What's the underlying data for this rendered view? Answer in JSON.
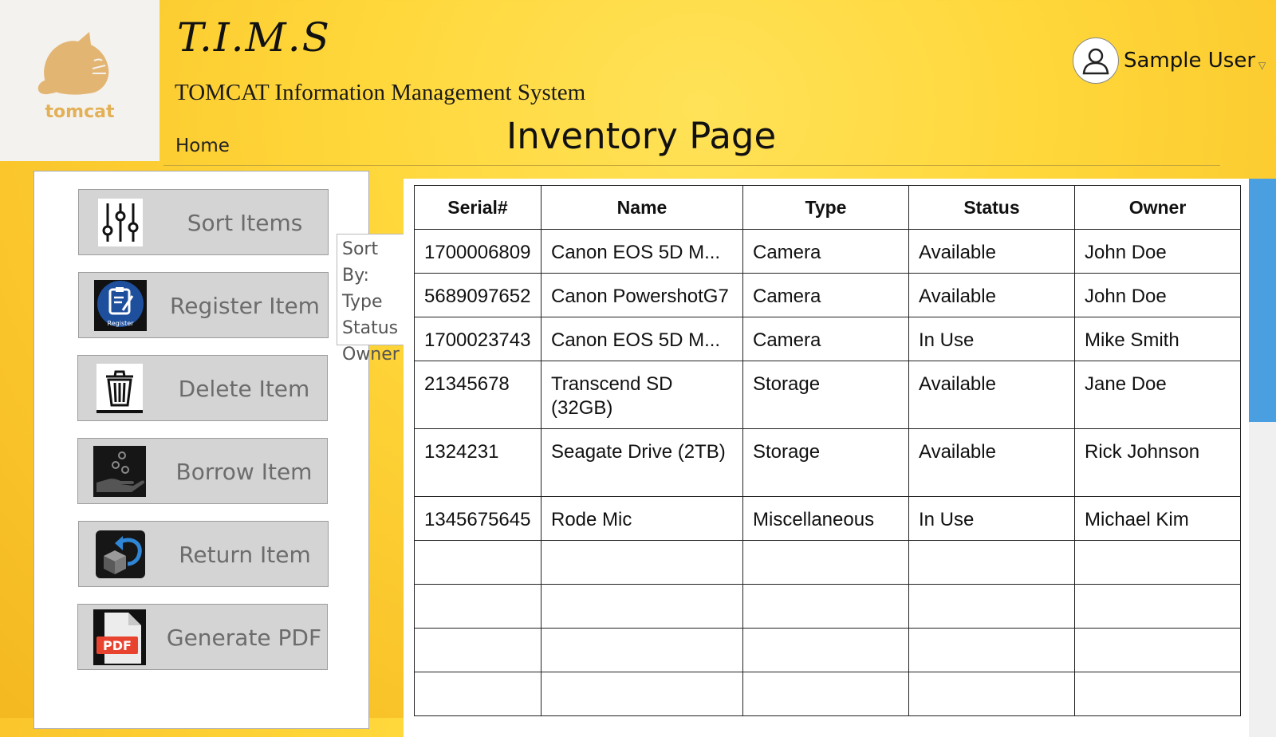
{
  "header": {
    "logo_text": "tomcat",
    "brand_title": "T.I.M.S",
    "brand_subtitle": "TOMCAT Information Management System",
    "nav_home": "Home",
    "page_title": "Inventory Page",
    "user_name": "Sample User"
  },
  "actions": [
    {
      "label": "Sort Items",
      "icon": "sliders-icon"
    },
    {
      "label": "Register Item",
      "icon": "register-clipboard-icon"
    },
    {
      "label": "Delete Item",
      "icon": "trash-icon"
    },
    {
      "label": "Borrow Item",
      "icon": "hand-coins-icon"
    },
    {
      "label": "Return Item",
      "icon": "return-box-icon"
    },
    {
      "label": "Generate PDF",
      "icon": "pdf-file-icon"
    }
  ],
  "sort_menu": {
    "title": "Sort By:",
    "options": [
      "Type",
      "Status",
      "Owner"
    ]
  },
  "table": {
    "columns": [
      "Serial#",
      "Name",
      "Type",
      "Status",
      "Owner"
    ],
    "rows": [
      {
        "serial": "1700006809",
        "name": "Canon EOS 5D M...",
        "type": "Camera",
        "status": "Available",
        "owner": "John Doe"
      },
      {
        "serial": "5689097652",
        "name": "Canon PowershotG7",
        "type": "Camera",
        "status": "Available",
        "owner": "John Doe"
      },
      {
        "serial": "1700023743",
        "name": "Canon EOS 5D M...",
        "type": "Camera",
        "status": "In Use",
        "owner": "Mike Smith"
      },
      {
        "serial": "21345678",
        "name": "Transcend SD (32GB)",
        "type": "Storage",
        "status": "Available",
        "owner": "Jane Doe"
      },
      {
        "serial": "1324231",
        "name": "Seagate Drive (2TB)",
        "type": "Storage",
        "status": "Available",
        "owner": "Rick Johnson"
      },
      {
        "serial": "1345675645",
        "name": "Rode Mic",
        "type": "Miscellaneous",
        "status": "In Use",
        "owner": "Michael Kim"
      }
    ],
    "empty_rows": 4
  },
  "colors": {
    "background": "#ffd73a",
    "button_bg": "#d4d4d4",
    "scroll_thumb": "#4a9fe0",
    "logo": "#e3b056"
  }
}
